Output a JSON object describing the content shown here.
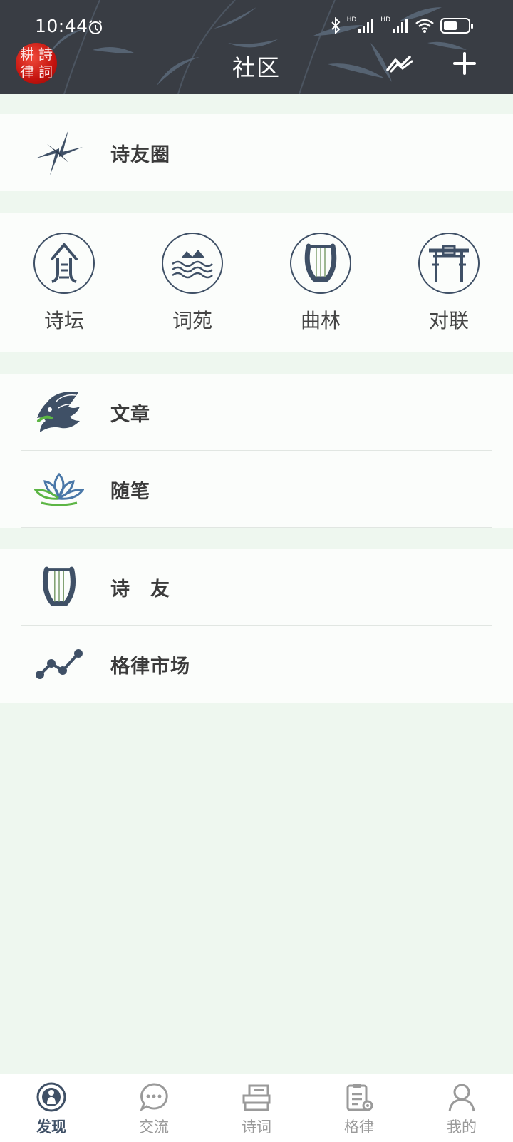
{
  "status_bar": {
    "time": "10:44",
    "battery_level": 0.55,
    "hd1": "HD",
    "hd2": "HD"
  },
  "header": {
    "title": "社区",
    "logo_chars": [
      "耕",
      "詩",
      "律",
      "詞"
    ]
  },
  "main": {
    "moments": {
      "label": "诗友圈",
      "icon": "pinwheel-icon"
    },
    "categories": [
      {
        "label": "诗坛",
        "icon": "pavilion-icon"
      },
      {
        "label": "词苑",
        "icon": "mountain-waves-icon"
      },
      {
        "label": "曲林",
        "icon": "lyre-icon"
      },
      {
        "label": "对联",
        "icon": "gate-icon"
      }
    ],
    "articles": [
      {
        "label": "文章",
        "icon": "dragon-icon"
      },
      {
        "label": "随笔",
        "icon": "lotus-icon"
      }
    ],
    "social": [
      {
        "label": "诗　友",
        "icon": "lyre-icon"
      },
      {
        "label": "格律市场",
        "icon": "trend-line-icon"
      }
    ]
  },
  "tabbar": {
    "active_index": 0,
    "tabs": [
      {
        "label": "发现",
        "icon": "discover-icon"
      },
      {
        "label": "交流",
        "icon": "chat-bubble-icon"
      },
      {
        "label": "诗词",
        "icon": "books-icon"
      },
      {
        "label": "格律",
        "icon": "clipboard-gear-icon"
      },
      {
        "label": "我的",
        "icon": "user-icon"
      }
    ]
  },
  "colors": {
    "header_bg": "#393d44",
    "page_bg": "#eef7ef",
    "card_bg": "#fbfdfb",
    "icon_navy": "#3f5066",
    "logo_red": "#c4130e",
    "tab_active": "#3f5066",
    "tab_inactive": "#9a9a9a"
  }
}
